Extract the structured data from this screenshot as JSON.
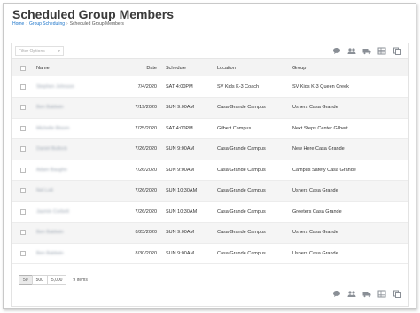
{
  "page": {
    "title": "Scheduled Group Members",
    "breadcrumb": [
      "Home",
      "Group Scheduling",
      "Scheduled Group Members"
    ]
  },
  "filter": {
    "placeholder": "Filter Options"
  },
  "table": {
    "headers": {
      "name": "Name",
      "date": "Date",
      "schedule": "Schedule",
      "location": "Location",
      "group": "Group"
    },
    "rows": [
      {
        "name": "Stephen Johnson",
        "date": "7/4/2020",
        "schedule": "SAT 4:00PM",
        "location": "SV Kids K-3 Coach",
        "group": "SV Kids K-3 Queen Creek"
      },
      {
        "name": "Ben Baldwin",
        "date": "7/19/2020",
        "schedule": "SUN 9:00AM",
        "location": "Casa Grande Campus",
        "group": "Ushers Casa Grande"
      },
      {
        "name": "Michelle Bloom",
        "date": "7/25/2020",
        "schedule": "SAT 4:00PM",
        "location": "Gilbert Campus",
        "group": "Next Steps Center Gilbert"
      },
      {
        "name": "Daniel Bullock",
        "date": "7/26/2020",
        "schedule": "SUN 9:00AM",
        "location": "Casa Grande Campus",
        "group": "New Here Casa Grande"
      },
      {
        "name": "Adam Baughn",
        "date": "7/26/2020",
        "schedule": "SUN 9:00AM",
        "location": "Casa Grande Campus",
        "group": "Campus Safety Casa Grande"
      },
      {
        "name": "Nel Lott",
        "date": "7/26/2020",
        "schedule": "SUN 10:30AM",
        "location": "Casa Grande Campus",
        "group": "Ushers Casa Grande"
      },
      {
        "name": "Jasmin Corbett",
        "date": "7/26/2020",
        "schedule": "SUN 10:30AM",
        "location": "Casa Grande Campus",
        "group": "Greeters Casa Grande"
      },
      {
        "name": "Ben Baldwin",
        "date": "8/23/2020",
        "schedule": "SUN 9:00AM",
        "location": "Casa Grande Campus",
        "group": "Ushers Casa Grande"
      },
      {
        "name": "Ben Baldwin",
        "date": "8/30/2020",
        "schedule": "SUN 9:00AM",
        "location": "Casa Grande Campus",
        "group": "Ushers Casa Grande"
      }
    ]
  },
  "pager": {
    "sizes": [
      "50",
      "500",
      "5,000"
    ],
    "selected": "50",
    "count_label": "9 Items"
  },
  "toolbar_icons": [
    "communicate-icon",
    "merge-person-icon",
    "bulk-update-icon",
    "export-excel-icon",
    "merge-template-icon"
  ]
}
